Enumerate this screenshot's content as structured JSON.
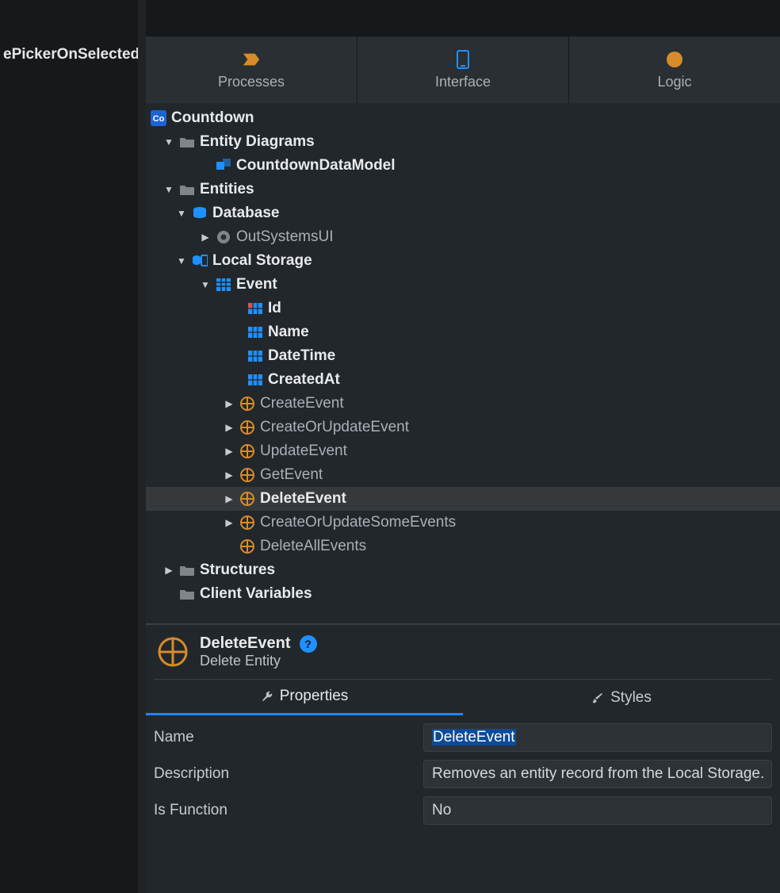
{
  "left_peek": "ePickerOnSelected",
  "tabs": {
    "processes": "Processes",
    "interface": "Interface",
    "logic": "Logic"
  },
  "tree": {
    "root": "Countdown",
    "entity_diagrams": "Entity Diagrams",
    "countdown_model": "CountdownDataModel",
    "entities": "Entities",
    "database": "Database",
    "outsystemsui": "OutSystemsUI",
    "local_storage": "Local Storage",
    "event": "Event",
    "attr_id": "Id",
    "attr_name": "Name",
    "attr_datetime": "DateTime",
    "attr_createdat": "CreatedAt",
    "act_create": "CreateEvent",
    "act_createorupdate": "CreateOrUpdateEvent",
    "act_update": "UpdateEvent",
    "act_get": "GetEvent",
    "act_delete": "DeleteEvent",
    "act_createupdatesome": "CreateOrUpdateSomeEvents",
    "act_deleteall": "DeleteAllEvents",
    "structures": "Structures",
    "client_vars": "Client Variables"
  },
  "details": {
    "title": "DeleteEvent",
    "subtitle": "Delete Entity",
    "help": "?",
    "tab_props": "Properties",
    "tab_styles": "Styles",
    "rows": {
      "name_key": "Name",
      "name_val": "DeleteEvent",
      "desc_key": "Description",
      "desc_val": "Removes an entity record from the Local Storage.",
      "func_key": "Is Function",
      "func_val": "No"
    }
  }
}
